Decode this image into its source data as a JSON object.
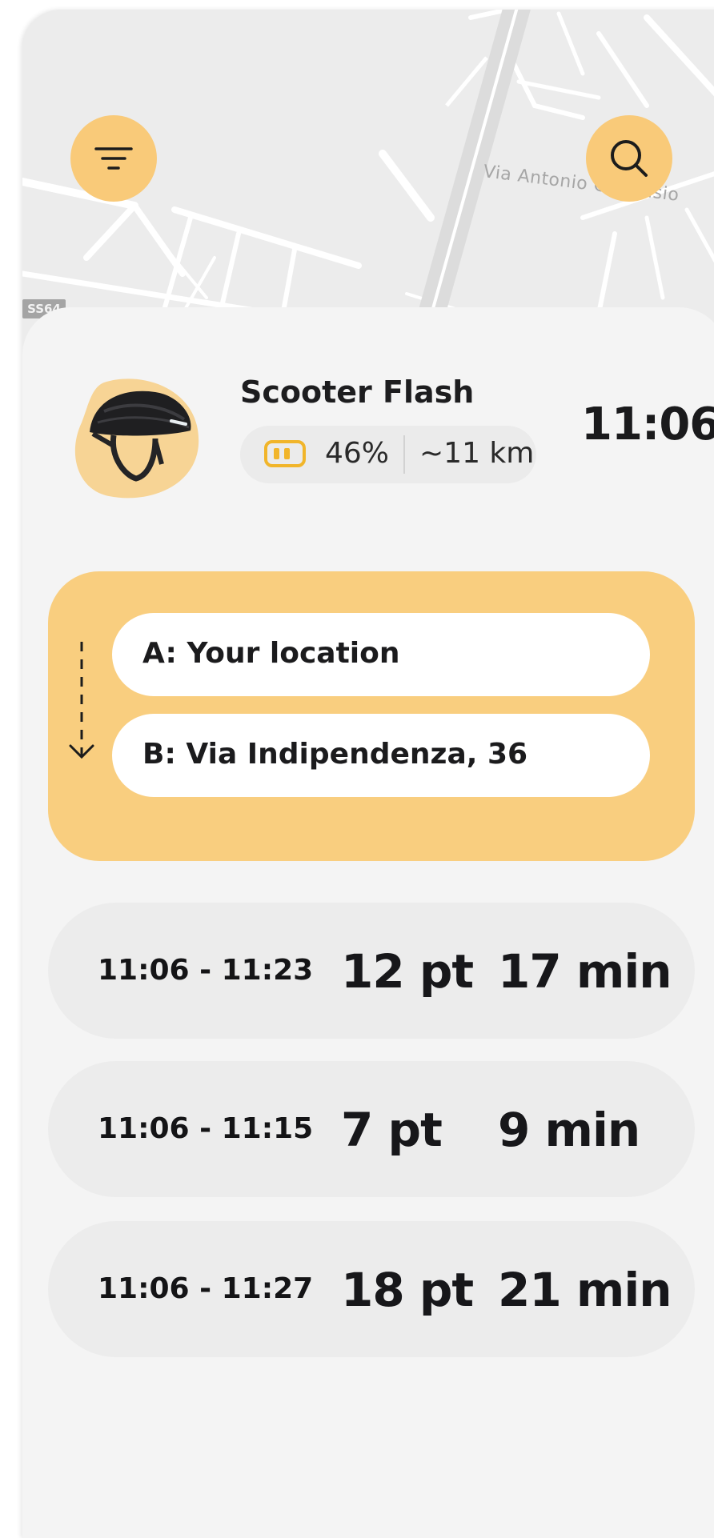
{
  "map": {
    "street_label": "Via Antonio Gandusio",
    "road_shield": "SS64",
    "top_label": "Via"
  },
  "vehicle": {
    "name": "Scooter Flash",
    "battery": "46%",
    "range": "~11 km",
    "image": "helmet-image"
  },
  "clock": "11:06",
  "route": {
    "from": "A: Your location",
    "to": "B: Via Indipendenza, 36"
  },
  "options": [
    {
      "time": "11:06 - 11:23",
      "points": "12 pt",
      "duration": "17 min"
    },
    {
      "time": "11:06 - 11:15",
      "points": "7 pt",
      "duration": "9 min"
    },
    {
      "time": "11:06 - 11:27",
      "points": "18 pt",
      "duration": "21 min"
    }
  ],
  "colors": {
    "accent": "#f9ca79",
    "battery": "#f1b52a",
    "sheet": "#f4f4f4"
  },
  "icons": {
    "filter": "filter-icon",
    "search": "search-icon",
    "battery": "battery-icon",
    "route": "route-arrow-icon"
  }
}
